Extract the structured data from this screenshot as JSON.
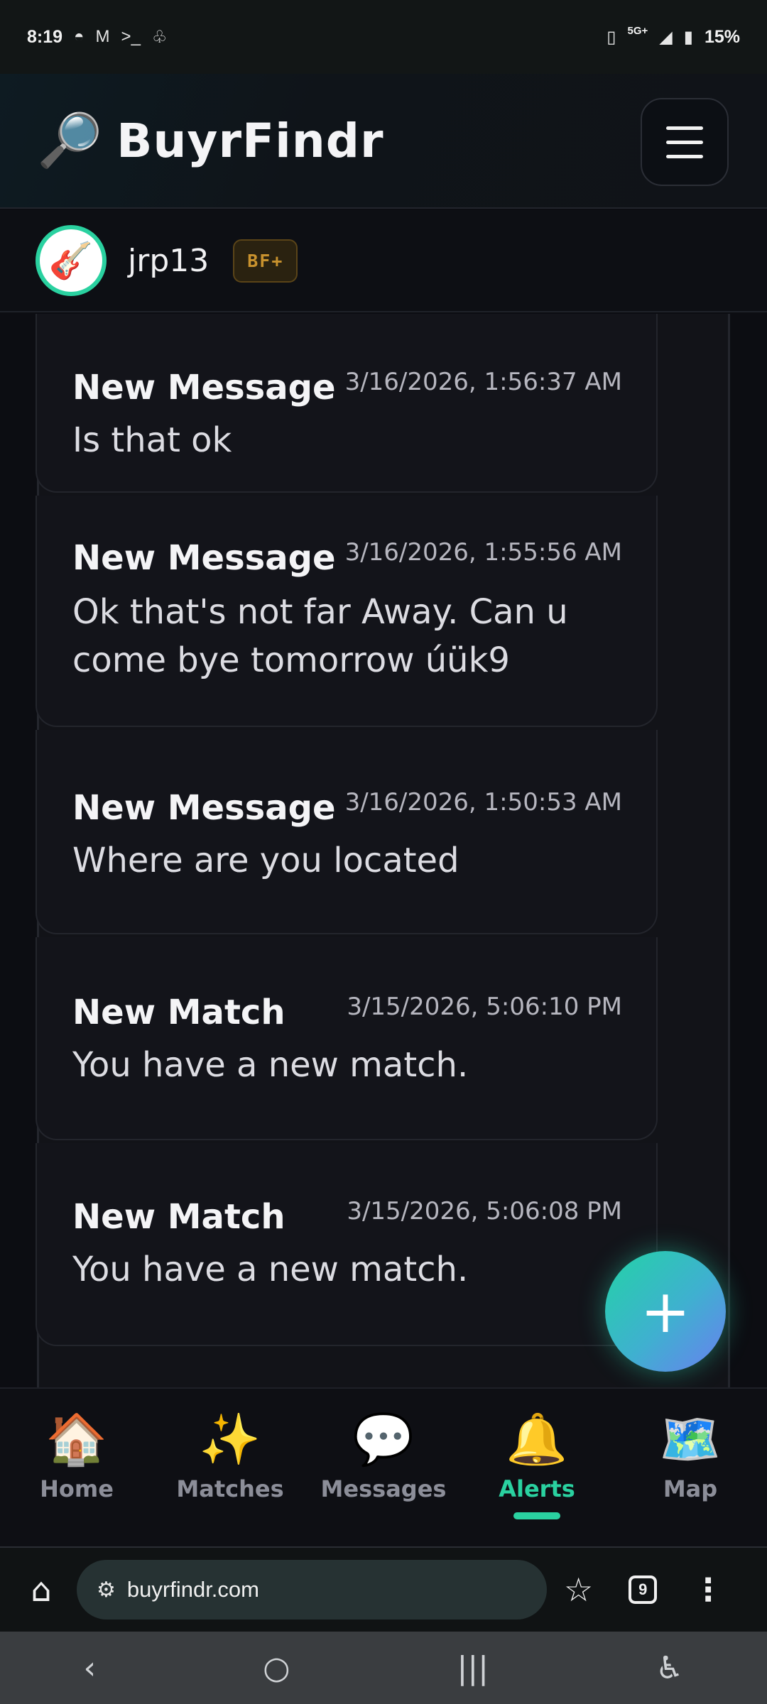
{
  "status_bar": {
    "time": "8:19",
    "left_icons": [
      "bowl-icon",
      "gmail-icon",
      "terminal-icon",
      "incognito-icon"
    ],
    "network": "5G+",
    "battery": "15%"
  },
  "header": {
    "logo_emoji": "🔎",
    "title": "BuyrFindr"
  },
  "profile": {
    "avatar_emoji": "🎸",
    "username": "jrp13",
    "badge": "BF+"
  },
  "alerts": [
    {
      "title": "New Message",
      "timestamp": "3/16/2026, 1:56:37 AM",
      "body": "Is that ok"
    },
    {
      "title": "New Message",
      "timestamp": "3/16/2026, 1:55:56 AM",
      "body": "Ok that's not far Away. Can u come bye tomorrow úük9"
    },
    {
      "title": "New Message",
      "timestamp": "3/16/2026, 1:50:53 AM",
      "body": "Where are you located"
    },
    {
      "title": "New Match",
      "timestamp": "3/15/2026, 5:06:10 PM",
      "body": "You have a new match."
    },
    {
      "title": "New Match",
      "timestamp": "3/15/2026, 5:06:08 PM",
      "body": "You have a new match."
    }
  ],
  "fab": {
    "label": "+"
  },
  "nav": [
    {
      "label": "Home",
      "icon": "🏠",
      "active": false
    },
    {
      "label": "Matches",
      "icon": "✨",
      "active": false
    },
    {
      "label": "Messages",
      "icon": "💬",
      "active": false
    },
    {
      "label": "Alerts",
      "icon": "🔔",
      "active": true
    },
    {
      "label": "Map",
      "icon": "🗺️",
      "active": false
    }
  ],
  "browser": {
    "url": "buyrfindr.com",
    "tab_count": "9"
  },
  "colors": {
    "accent": "#2ad1a0",
    "badge_text": "#c8922e",
    "background": "#0c0d12"
  }
}
